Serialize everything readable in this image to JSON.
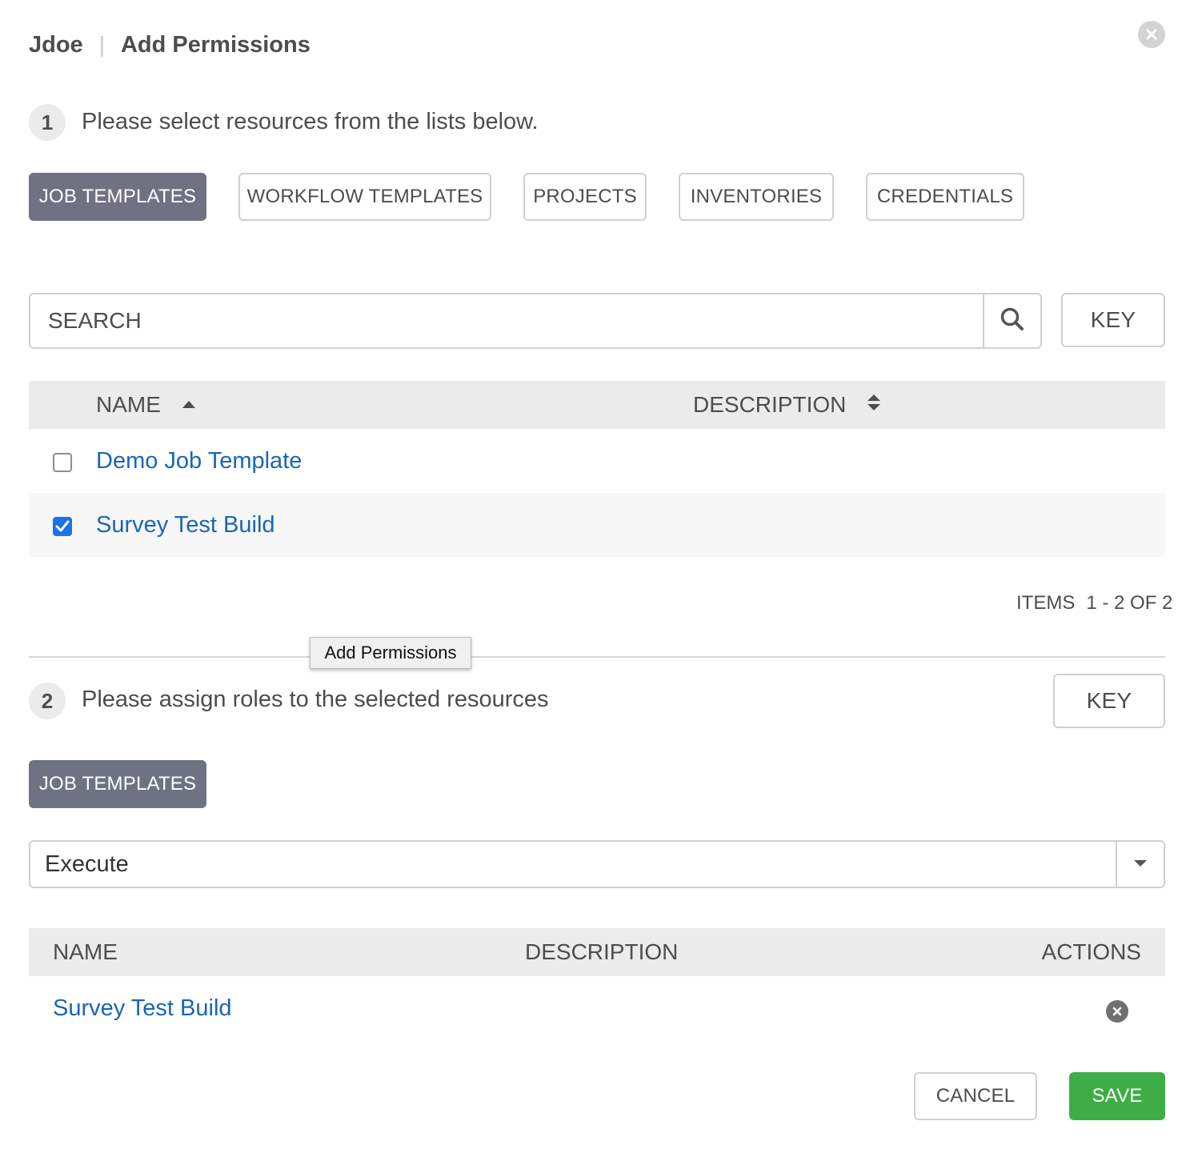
{
  "header": {
    "user": "Jdoe",
    "separator": "|",
    "title": "Add Permissions"
  },
  "step1": {
    "number": "1",
    "text": "Please select resources from the lists below.",
    "tabs": [
      {
        "label": "JOB TEMPLATES",
        "active": true
      },
      {
        "label": "WORKFLOW TEMPLATES",
        "active": false
      },
      {
        "label": "PROJECTS",
        "active": false
      },
      {
        "label": "INVENTORIES",
        "active": false
      },
      {
        "label": "CREDENTIALS",
        "active": false
      }
    ],
    "search": {
      "placeholder": "SEARCH"
    },
    "key_label": "KEY",
    "table": {
      "columns": [
        "NAME",
        "DESCRIPTION"
      ],
      "rows": [
        {
          "name": "Demo Job Template",
          "description": "",
          "checked": false
        },
        {
          "name": "Survey Test Build",
          "description": "",
          "checked": true
        }
      ]
    },
    "pagination": {
      "prefix": "ITEMS",
      "range": "1 - 2 OF 2"
    }
  },
  "tooltip": "Add Permissions",
  "step2": {
    "number": "2",
    "text": "Please assign roles to the selected resources",
    "key_label": "KEY",
    "tab": "JOB TEMPLATES",
    "role_select": {
      "value": "Execute"
    },
    "table": {
      "columns": [
        "NAME",
        "DESCRIPTION",
        "ACTIONS"
      ],
      "rows": [
        {
          "name": "Survey Test Build",
          "description": ""
        }
      ]
    }
  },
  "footer": {
    "cancel_label": "CANCEL",
    "save_label": "SAVE"
  },
  "colors": {
    "active_tab": "#6f7282",
    "link": "#1a66b3",
    "save": "#3fad46",
    "checkbox_checked": "#1b73e8"
  },
  "icons": {
    "close": "close-circle-icon",
    "search": "search-icon",
    "sort_asc": "sort-up-icon",
    "sort_both": "sort-icon",
    "dropdown": "caret-down-icon",
    "remove": "remove-circle-icon"
  }
}
